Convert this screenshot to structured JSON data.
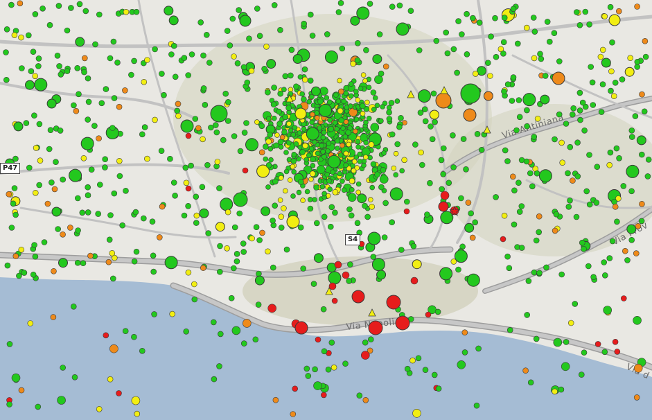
{
  "map": {
    "colors": {
      "sea": "#a5bcd4",
      "land": "#e9e8e3",
      "road": "#b9b9b9",
      "road_casing": "#9d9d9d",
      "green": "#23c81e",
      "yellow": "#f2ee12",
      "orange": "#ee8a1a",
      "red": "#e61c1c"
    },
    "road_labels": {
      "antiniana": "Via Antiniana",
      "napoli": "Via Napoli",
      "provinciale": "Via Prov",
      "partial_d": "Via d"
    },
    "shields": {
      "p47": "P47",
      "s4": "S4"
    },
    "markers": {
      "legend": [
        "green",
        "yellow",
        "orange",
        "red"
      ]
    }
  }
}
